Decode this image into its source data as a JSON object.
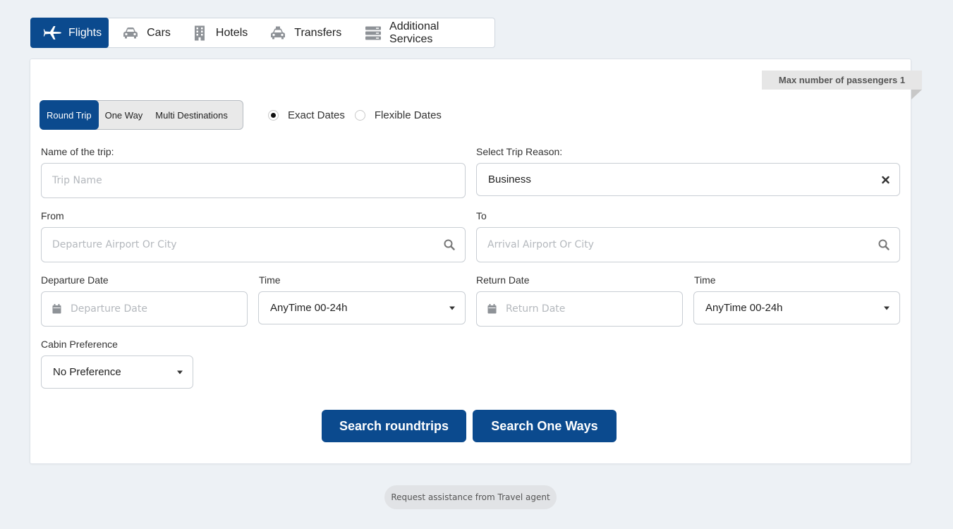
{
  "tabs": [
    {
      "label": "Flights",
      "icon": "plane-icon",
      "active": true
    },
    {
      "label": "Cars",
      "icon": "car-icon"
    },
    {
      "label": "Hotels",
      "icon": "building-icon"
    },
    {
      "label": "Transfers",
      "icon": "taxi-icon"
    },
    {
      "label": "Additional Services",
      "icon": "server-icon"
    }
  ],
  "passengers_badge": "Max number of passengers 1",
  "trip_types": [
    "Round Trip",
    "One Way",
    "Multi Destinations"
  ],
  "date_modes": [
    "Exact Dates",
    "Flexible Dates"
  ],
  "form": {
    "trip_name_label": "Name of the trip:",
    "trip_name_placeholder": "Trip Name",
    "reason_label": "Select Trip Reason:",
    "reason_value": "Business",
    "from_label": "From",
    "from_placeholder": "Departure Airport Or City",
    "to_label": "To",
    "to_placeholder": "Arrival Airport Or City",
    "departure_date_label": "Departure Date",
    "departure_date_placeholder": "Departure Date",
    "departure_time_label": "Time",
    "departure_time_value": "AnyTime 00-24h",
    "return_date_label": "Return Date",
    "return_date_placeholder": "Return Date",
    "return_time_label": "Time",
    "return_time_value": "AnyTime 00-24h",
    "cabin_label": "Cabin Preference",
    "cabin_value": "No Preference"
  },
  "actions": {
    "search_roundtrips": "Search roundtrips",
    "search_one_ways": "Search One Ways"
  },
  "assist_label": "Request assistance from Travel agent",
  "colors": {
    "primary": "#0b4a8e",
    "background": "#edf1f5"
  }
}
